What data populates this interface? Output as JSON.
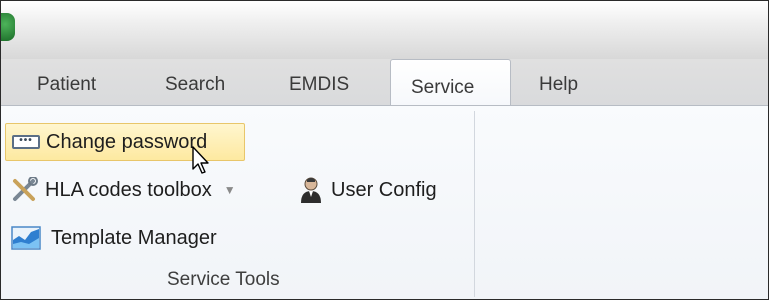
{
  "window": {
    "app_icon": "app-logo-icon"
  },
  "tabs": [
    {
      "label": "Patient",
      "active": false
    },
    {
      "label": "Search",
      "active": false
    },
    {
      "label": "EMDIS",
      "active": false
    },
    {
      "label": "Service",
      "active": true
    },
    {
      "label": "Help",
      "active": false
    }
  ],
  "ribbon": {
    "group_label": "Service Tools",
    "items": {
      "change_password": {
        "label": "Change password",
        "icon": "password-field-icon",
        "state": "hover"
      },
      "hla_codes_toolbox": {
        "label": "HLA codes toolbox",
        "icon": "tools-icon",
        "has_dropdown": true
      },
      "user_config": {
        "label": "User Config",
        "icon": "user-icon"
      },
      "template_manager": {
        "label": "Template Manager",
        "icon": "chart-icon"
      }
    }
  },
  "colors": {
    "hover_bg": "#fde9a0",
    "hover_border": "#e8c66a",
    "tab_text": "#3a3a3a",
    "ribbon_bg": "#f6f8fb"
  }
}
